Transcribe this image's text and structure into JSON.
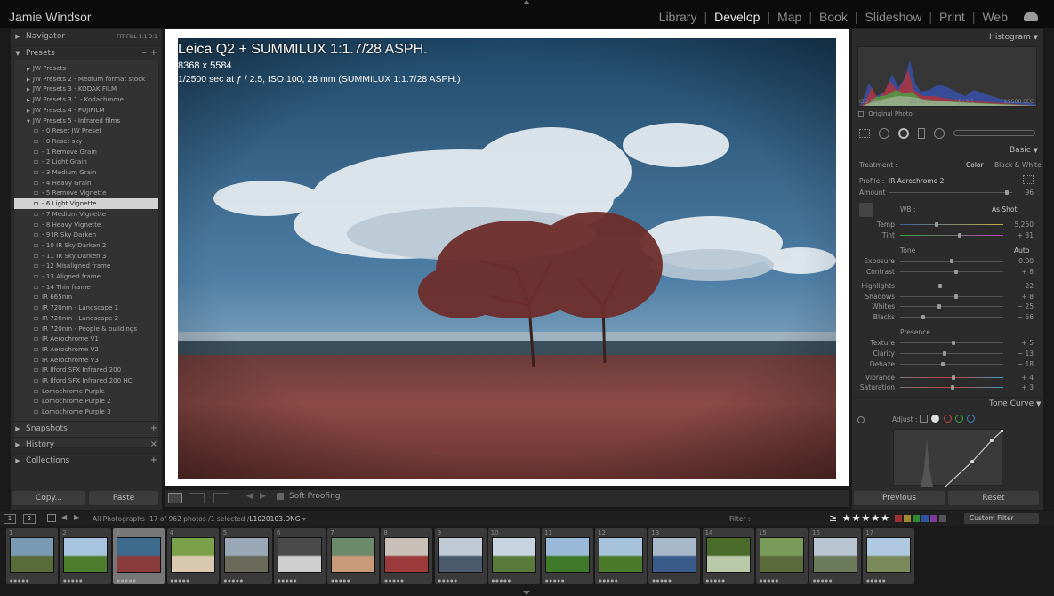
{
  "identity_plate": "Jamie Windsor",
  "modules": [
    {
      "label": "Library",
      "active": false
    },
    {
      "label": "Develop",
      "active": true
    },
    {
      "label": "Map",
      "active": false
    },
    {
      "label": "Book",
      "active": false
    },
    {
      "label": "Slideshow",
      "active": false
    },
    {
      "label": "Print",
      "active": false
    },
    {
      "label": "Web",
      "active": false
    }
  ],
  "left_panel": {
    "navigator": {
      "title": "Navigator",
      "zoom_options": [
        "FIT",
        "FILL",
        "1:1",
        "3:1"
      ]
    },
    "presets": {
      "title": "Presets",
      "minus": "–",
      "plus": "+",
      "items": [
        {
          "label": "JW Presets",
          "type": "folder"
        },
        {
          "label": "JW Presets 2 - Medium format stock",
          "type": "folder"
        },
        {
          "label": "JW Presets 3 - KODAK FILM",
          "type": "folder"
        },
        {
          "label": "JW Presets 3.1 - Kodachrome",
          "type": "folder"
        },
        {
          "label": "JW Presets 4 - FUJIFILM",
          "type": "folder"
        },
        {
          "label": "JW Presets 5 - Infrared films",
          "type": "folder-open"
        },
        {
          "label": "- 0 Reset JW Preset",
          "type": "preset"
        },
        {
          "label": "- 0 Reset sky",
          "type": "preset"
        },
        {
          "label": "- 1 Remove Grain",
          "type": "preset"
        },
        {
          "label": "- 2 Light Grain",
          "type": "preset"
        },
        {
          "label": "- 3 Medium Grain",
          "type": "preset"
        },
        {
          "label": "- 4 Heavy Grain",
          "type": "preset"
        },
        {
          "label": "- 5 Remove Vignette",
          "type": "preset"
        },
        {
          "label": "- 6 Light Vignette",
          "type": "preset",
          "selected": true
        },
        {
          "label": "- 7 Medium Vignette",
          "type": "preset"
        },
        {
          "label": "- 8 Heavy Vignette",
          "type": "preset"
        },
        {
          "label": "- 9 IR Sky Darken",
          "type": "preset"
        },
        {
          "label": "- 10 IR Sky Darken 2",
          "type": "preset"
        },
        {
          "label": "- 11 IR Sky Darken 3",
          "type": "preset"
        },
        {
          "label": "- 12 Misaligned frame",
          "type": "preset"
        },
        {
          "label": "- 13 Aligned frame",
          "type": "preset"
        },
        {
          "label": "- 14 Thin frame",
          "type": "preset"
        },
        {
          "label": "IR 665nm",
          "type": "preset"
        },
        {
          "label": "IR 720nm - Landscape 1",
          "type": "preset"
        },
        {
          "label": "IR 720nm - Landscape 2",
          "type": "preset"
        },
        {
          "label": "IR 720nm - People & buildings",
          "type": "preset"
        },
        {
          "label": "IR Aerochrome V1",
          "type": "preset"
        },
        {
          "label": "IR Aerochrome V2",
          "type": "preset"
        },
        {
          "label": "IR Aerochrome V3",
          "type": "preset"
        },
        {
          "label": "IR Ilford SFX Infrared 200",
          "type": "preset"
        },
        {
          "label": "IR Ilford SFX Infrared 200 HC",
          "type": "preset"
        },
        {
          "label": "Lomochrome Purple",
          "type": "preset"
        },
        {
          "label": "Lomochrome Purple 2",
          "type": "preset"
        },
        {
          "label": "Lomochrome Purple 3",
          "type": "preset"
        }
      ]
    },
    "snapshots": {
      "title": "Snapshots",
      "action": "+"
    },
    "history": {
      "title": "History",
      "action": "×"
    },
    "collections": {
      "title": "Collections",
      "action": "+"
    },
    "copy_button": "Copy...",
    "paste_button": "Paste"
  },
  "photo_info": {
    "line1": "Leica Q2 + SUMMILUX 1:1.7/28 ASPH.",
    "line2": "8368 x 5584",
    "line3_shutter": "1/2500",
    "line3": "sec at ƒ / 2.5, ISO 100, 28 mm (SUMMILUX 1:1.7/28 ASPH.)"
  },
  "toolbar": {
    "soft_proofing": "Soft Proofing"
  },
  "right_panel": {
    "histogram": {
      "title": "Histogram",
      "meta": [
        "ISO 100",
        "28 mm",
        "ƒ / 2.5",
        "1⁄2500 SEC"
      ],
      "original_photo": "Original Photo"
    },
    "basic": {
      "title": "Basic",
      "treatment_label": "Treatment :",
      "treatment_color": "Color",
      "treatment_bw": "Black & White",
      "profile_label": "Profile :",
      "profile_value": "IR Aerochrome 2",
      "amount_label": "Amount",
      "amount_value": "96",
      "amount_level": 0.96,
      "wb_label": "WB :",
      "wb_value": "As Shot",
      "tone_label": "Tone",
      "tone_auto": "Auto",
      "presence_label": "Presence",
      "sliders": [
        {
          "label": "Temp",
          "value": "5,250",
          "level": 0.35
        },
        {
          "label": "Tint",
          "value": "+ 31",
          "level": 0.58
        },
        {
          "label": "Exposure",
          "value": "0.00",
          "level": 0.5
        },
        {
          "label": "Contrast",
          "value": "+ 8",
          "level": 0.54
        },
        {
          "label": "Highlights",
          "value": "− 22",
          "level": 0.39
        },
        {
          "label": "Shadows",
          "value": "+ 8",
          "level": 0.54
        },
        {
          "label": "Whites",
          "value": "− 25",
          "level": 0.375
        },
        {
          "label": "Blacks",
          "value": "− 56",
          "level": 0.22
        },
        {
          "label": "Texture",
          "value": "+ 5",
          "level": 0.52
        },
        {
          "label": "Clarity",
          "value": "− 13",
          "level": 0.43
        },
        {
          "label": "Dehaze",
          "value": "− 18",
          "level": 0.41
        },
        {
          "label": "Vibrance",
          "value": "+ 4",
          "level": 0.52
        },
        {
          "label": "Saturation",
          "value": "+ 3",
          "level": 0.51
        }
      ]
    },
    "tone_curve": {
      "title": "Tone Curve",
      "adjust_label": "Adjust :"
    },
    "previous_button": "Previous",
    "reset_button": "Reset"
  },
  "filmstrip_bar": {
    "screen1": "1",
    "screen2": "2",
    "source": "All Photographs",
    "count": "17 of 962 photos /1 selected /",
    "filename": "L1020103.DNG",
    "filter_label": "Filter :",
    "custom_filter": "Custom Filter"
  },
  "filmstrip": [
    {
      "num": "1",
      "colors": [
        "#7a9bb3",
        "#5a6b3a"
      ]
    },
    {
      "num": "2",
      "colors": [
        "#a9c4e0",
        "#4f7d2e"
      ]
    },
    {
      "num": "3",
      "colors": [
        "#3c6b8e",
        "#8a3c3c"
      ],
      "selected": true
    },
    {
      "num": "4",
      "colors": [
        "#7aa04a",
        "#d8c8b0"
      ]
    },
    {
      "num": "5",
      "colors": [
        "#9aa7b5",
        "#6a6a5a"
      ]
    },
    {
      "num": "6",
      "colors": [
        "#4a4a4a",
        "#cfcfcf"
      ]
    },
    {
      "num": "7",
      "colors": [
        "#6a8a6a",
        "#c89a7a"
      ]
    },
    {
      "num": "8",
      "colors": [
        "#c8c0b8",
        "#9a3a3a"
      ]
    },
    {
      "num": "9",
      "colors": [
        "#c0cad4",
        "#4a5a6a"
      ]
    },
    {
      "num": "10",
      "colors": [
        "#c8d4e0",
        "#5a7a3a"
      ]
    },
    {
      "num": "11",
      "colors": [
        "#9ab8d8",
        "#3e7a2a"
      ]
    },
    {
      "num": "12",
      "colors": [
        "#a8c4dc",
        "#4a7a2a"
      ]
    },
    {
      "num": "13",
      "colors": [
        "#a8b8c8",
        "#3a5a8a"
      ]
    },
    {
      "num": "14",
      "colors": [
        "#4a6a2a",
        "#b8c8a8"
      ]
    },
    {
      "num": "15",
      "colors": [
        "#7a9a5a",
        "#5a6a3a"
      ]
    },
    {
      "num": "16",
      "colors": [
        "#b8c4d0",
        "#6a7a5a"
      ]
    },
    {
      "num": "17",
      "colors": [
        "#b0c8e0",
        "#7a8a5a"
      ]
    }
  ]
}
